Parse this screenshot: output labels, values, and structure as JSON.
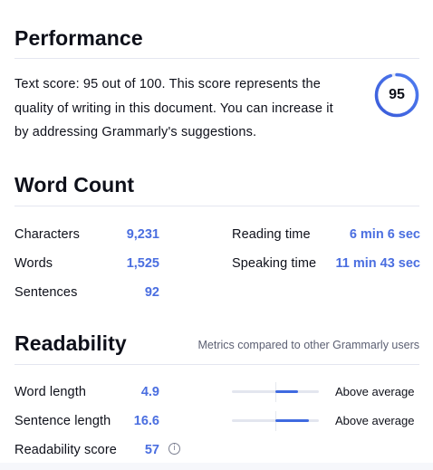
{
  "performance": {
    "title": "Performance",
    "description": "Text score: 95 out of 100. This score represents the quality of writing in this document. You can increase it by addressing Grammarly's suggestions.",
    "score": "95",
    "score_fraction": 0.95
  },
  "word_count": {
    "title": "Word Count",
    "characters_label": "Characters",
    "characters_value": "9,231",
    "words_label": "Words",
    "words_value": "1,525",
    "sentences_label": "Sentences",
    "sentences_value": "92",
    "reading_time_label": "Reading time",
    "reading_time_value": "6 min 6 sec",
    "speaking_time_label": "Speaking time",
    "speaking_time_value": "11 min 43 sec"
  },
  "readability": {
    "title": "Readability",
    "note": "Metrics compared to other Grammarly users",
    "word_length_label": "Word length",
    "word_length_value": "4.9",
    "word_length_comparison": "Above average",
    "sentence_length_label": "Sentence length",
    "sentence_length_value": "16.6",
    "sentence_length_comparison": "Above average",
    "score_label": "Readability score",
    "score_value": "57",
    "info_icon": "i"
  },
  "colors": {
    "accent": "#4a6ee0",
    "ring_track": "#e8ebf5",
    "divider": "#e4e6f0"
  }
}
